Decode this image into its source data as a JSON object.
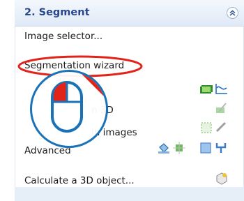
{
  "panel": {
    "title": "2. Segment",
    "tasks": [
      {
        "label": "Image selector..."
      },
      {
        "label": "Segmentation wizard"
      },
      {
        "label": ""
      },
      {
        "label": "n 3D"
      },
      {
        "label": "in images"
      },
      {
        "label": "Advanced"
      },
      {
        "label": "Calculate a 3D object..."
      }
    ]
  },
  "colors": {
    "header_text": "#29488b",
    "highlight_ellipse": "#e2231a",
    "mouse_outline": "#1a73b8",
    "mouse_button": "#e2231a"
  },
  "icons": {
    "collapse": "chevron-up-icon",
    "mouse": "mouse-icon",
    "filmstrip": "filmstrip-icon",
    "curve": "curve-icon",
    "brush": "brush-icon",
    "pencil": "pencil-icon",
    "dashed_rect": "dashed-rect-icon",
    "paint_bucket": "paint-bucket-icon",
    "morph": "morph-icon",
    "square": "square-icon",
    "split": "split-icon",
    "object3d": "object3d-icon"
  }
}
